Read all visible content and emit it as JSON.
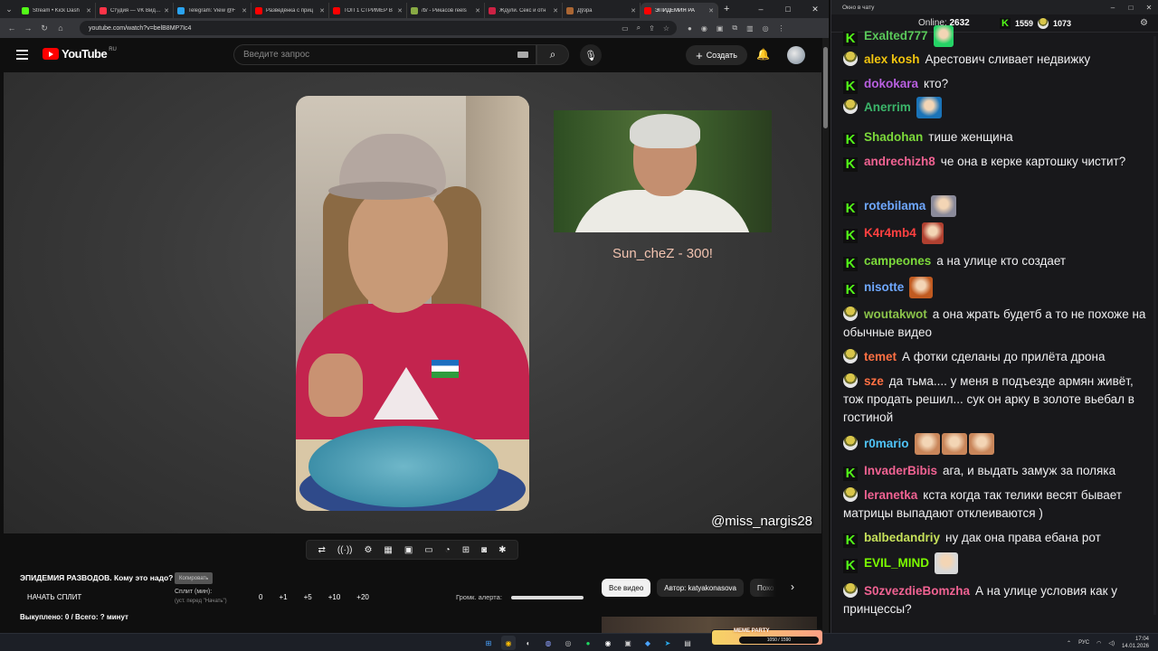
{
  "browser": {
    "tabs": [
      {
        "title": "Stream • Kick Dash",
        "color": "#53fc18"
      },
      {
        "title": "Студия — VK Видео",
        "color": "#ff3347"
      },
      {
        "title": "Telegram: View @F",
        "color": "#2aa3ef"
      },
      {
        "title": "Разведёнка с приц",
        "color": "#ff0000"
      },
      {
        "title": "ТОП 1 СТРИМЕР В",
        "color": "#ff0000"
      },
      {
        "title": "/b/ - Рикасов reels",
        "color": "#88aa44"
      },
      {
        "title": "Ждули. Секс и отн",
        "color": "#cc2244"
      },
      {
        "title": "Дўзра",
        "color": "#aa6633"
      },
      {
        "title": "ЭПИДЕМИЯ РА",
        "color": "#ff0000"
      }
    ],
    "url": "youtube.com/watch?v=belB8MP7Ic4"
  },
  "youtube": {
    "region": "RU",
    "logo_text": "YouTube",
    "search_placeholder": "Введите запрос",
    "create_label": "Создать"
  },
  "video": {
    "inset_caption": "Sun_cheZ - 300!",
    "watermark": "@miss_nargis28"
  },
  "plugin": {
    "title": "ЭПИДЕМИЯ РАЗВОДОВ. Кому это надо?",
    "copy_label": "Копировать",
    "start_split": "НАЧАТЬ СПЛИТ",
    "split_label": "Сплит (мин):",
    "split_hint": "(уст. перед \"Начать\")",
    "split_values": [
      "0",
      "+1",
      "+5",
      "+10",
      "+20"
    ],
    "bought": "Выкуплено: 0 / Всего: ? минут",
    "alert_label": "Громк. алерта:",
    "alert_volume": 1.0
  },
  "chips": [
    "Все видео",
    "Автор: katyakonasova",
    "Похо"
  ],
  "chat": {
    "window_title": "Окно в чату",
    "online_label": "Online:",
    "online_count": "2632",
    "stat1": "1559",
    "stat2": "1073",
    "messages": [
      {
        "badge": "k",
        "nick": "Exalted777",
        "color": "#5ac85a",
        "text": "",
        "emotes": [
          {
            "w": 22,
            "color": "#25d366"
          }
        ]
      },
      {
        "badge": "hat",
        "nick": "alex kosh",
        "color": "#f1c40f",
        "text": "Арестович сливает недвижку",
        "emotes": []
      },
      {
        "badge": "k",
        "nick": "dokokara",
        "color": "#b85fe0",
        "text": "кто?",
        "emotes": []
      },
      {
        "badge": "hat",
        "nick": "Anerrim",
        "color": "#3bb56a",
        "text": "",
        "emotes": [
          {
            "w": 28,
            "color": "#1a73b8"
          }
        ]
      },
      {
        "badge": "k",
        "nick": "Shadohan",
        "color": "#7cd93b",
        "text": "тише женщина",
        "emotes": []
      },
      {
        "badge": "k",
        "nick": "andrechizh8",
        "color": "#f06292",
        "text": "че она в керке картошку чистит?",
        "emotes": []
      },
      {
        "badge": "k",
        "nick": "rotebilama",
        "color": "#6fa8ff",
        "text": "",
        "emotes": [
          {
            "w": 28,
            "color": "#8a8a9a"
          }
        ]
      },
      {
        "badge": "k",
        "nick": "K4r4mb4",
        "color": "#ff4040",
        "text": "",
        "emotes": [
          {
            "w": 24,
            "color": "#b04030"
          }
        ]
      },
      {
        "badge": "k",
        "nick": "campeones",
        "color": "#7cd93b",
        "text": "а на улице кто создает",
        "emotes": []
      },
      {
        "badge": "k",
        "nick": "nisotte",
        "color": "#6fa8ff",
        "text": "",
        "emotes": [
          {
            "w": 26,
            "color": "#c05a20"
          }
        ]
      },
      {
        "badge": "hat",
        "nick": "woutakwot",
        "color": "#8bc34a",
        "text": "а она жрать будетб а то не похоже на обычные видео",
        "emotes": []
      },
      {
        "badge": "hat",
        "nick": "temet",
        "color": "#ff7043",
        "text": "А фотки сделаны до прилёта дрона",
        "emotes": []
      },
      {
        "badge": "hat",
        "nick": "sze",
        "color": "#ff7043",
        "text": "да тьма.... у меня в подъезде армян живёт, тож продать решил... сук он арку в золоте вьебал в гостиной",
        "emotes": []
      },
      {
        "badge": "hat",
        "nick": "r0mario",
        "color": "#4fc3f7",
        "text": "",
        "emotes": [
          {
            "w": 28,
            "color": "#c9865a"
          },
          {
            "w": 28,
            "color": "#c9865a"
          },
          {
            "w": 28,
            "color": "#c9865a"
          }
        ]
      },
      {
        "badge": "k",
        "nick": "InvaderBibis",
        "color": "#f06292",
        "text": "ага, и выдать замуж за поляка",
        "emotes": []
      },
      {
        "badge": "hat",
        "nick": "leranetka",
        "color": "#f06292",
        "text": "кста когда так телики весят бывает матрицы выпадают отклеиваются )",
        "emotes": []
      },
      {
        "badge": "k",
        "nick": "balbedandriy",
        "color": "#c6e05a",
        "text": "ну дак она права ебана рот",
        "emotes": []
      },
      {
        "badge": "k",
        "nick": "EVIL_MIND",
        "color": "#7cfc00",
        "text": "",
        "emotes": [
          {
            "w": 26,
            "color": "#d8d8d8"
          }
        ]
      },
      {
        "badge": "hat",
        "nick": "S0zvezdieBomzha",
        "color": "#f06292",
        "text": "А на улице условия как у принцессы?",
        "emotes": []
      }
    ]
  },
  "taskbar": {
    "meme_title": "MEME PARTY",
    "meme_progress": "1050 / 1590",
    "lang": "РУС",
    "time": "17:04",
    "date": "14.01.2026"
  }
}
